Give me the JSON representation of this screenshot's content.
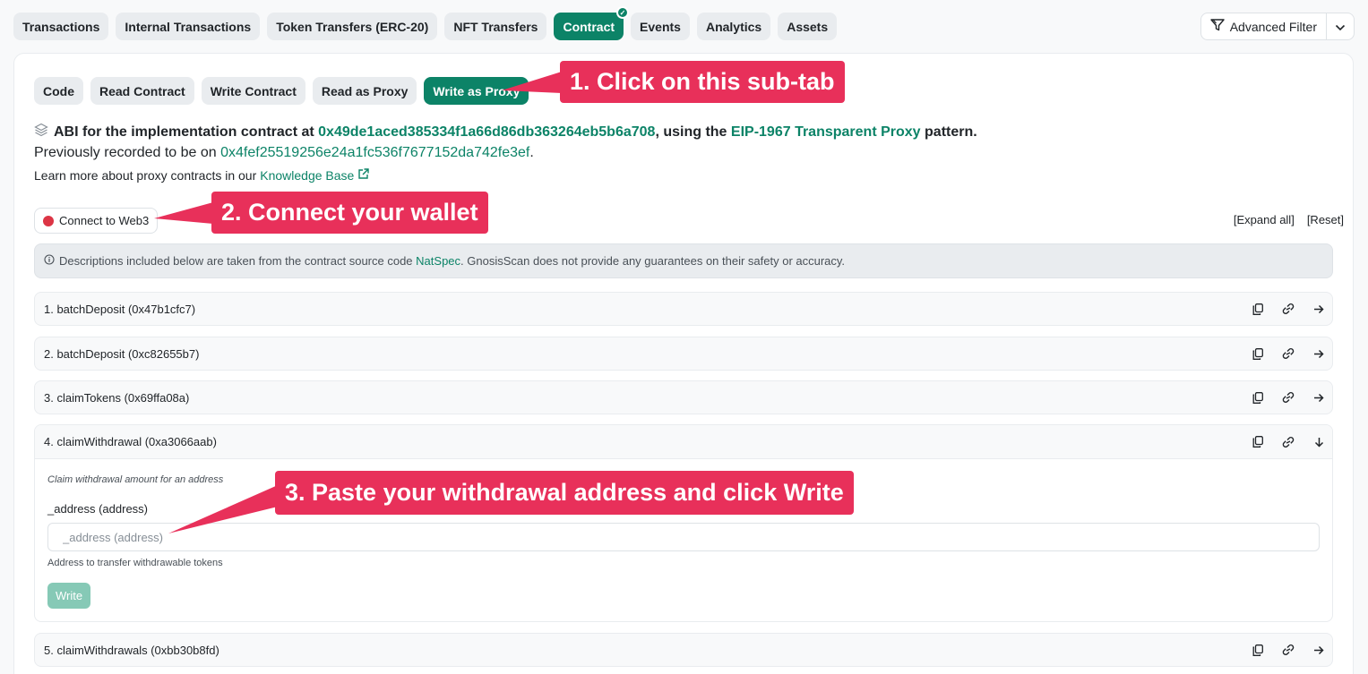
{
  "top_tabs": [
    {
      "label": "Transactions"
    },
    {
      "label": "Internal Transactions"
    },
    {
      "label": "Token Transfers (ERC-20)"
    },
    {
      "label": "NFT Transfers"
    },
    {
      "label": "Contract",
      "active": true
    },
    {
      "label": "Events"
    },
    {
      "label": "Analytics"
    },
    {
      "label": "Assets"
    }
  ],
  "advanced_filter": {
    "label": "Advanced Filter"
  },
  "sub_tabs": [
    {
      "label": "Code"
    },
    {
      "label": "Read Contract"
    },
    {
      "label": "Write Contract"
    },
    {
      "label": "Read as Proxy"
    },
    {
      "label": "Write as Proxy",
      "active": true
    }
  ],
  "abi": {
    "prefix": "ABI for the implementation contract at",
    "address": "0x49de1aced385334f1a66d86db363264eb5b6a708",
    "middle": ", using the",
    "pattern": "EIP-1967 Transparent Proxy",
    "suffix": "pattern."
  },
  "previous": {
    "prefix": "Previously recorded to be on",
    "address": "0x4fef25519256e24a1fc536f7677152da742fe3ef",
    "suffix": "."
  },
  "learn": {
    "prefix": "Learn more about proxy contracts in our",
    "link": "Knowledge Base"
  },
  "connect": {
    "label": "Connect to Web3"
  },
  "expand_all": "[Expand all]",
  "reset": "[Reset]",
  "notice": {
    "prefix": "Descriptions included below are taken from the contract source code",
    "link": "NatSpec",
    "suffix": ". GnosisScan does not provide any guarantees on their safety or accuracy."
  },
  "functions": [
    {
      "label": "1. batchDeposit (0x47b1cfc7)"
    },
    {
      "label": "2. batchDeposit (0xc82655b7)"
    },
    {
      "label": "3. claimTokens (0x69ffa08a)"
    },
    {
      "label": "4. claimWithdrawal (0xa3066aab)"
    },
    {
      "label": "5. claimWithdrawals (0xbb30b8fd)"
    }
  ],
  "expanded_function": {
    "description": "Claim withdrawal amount for an address",
    "param_label": "_address (address)",
    "param_placeholder": "_address (address)",
    "param_help": "Address to transfer withdrawable tokens",
    "write_label": "Write"
  },
  "callouts": [
    {
      "text": "1. Click on this sub-tab"
    },
    {
      "text": "2. Connect your wallet"
    },
    {
      "text": "3. Paste your withdrawal address and click Write"
    }
  ],
  "colors": {
    "accent": "#0c8367",
    "callout": "#e8305a",
    "status_red": "#dc3545"
  }
}
